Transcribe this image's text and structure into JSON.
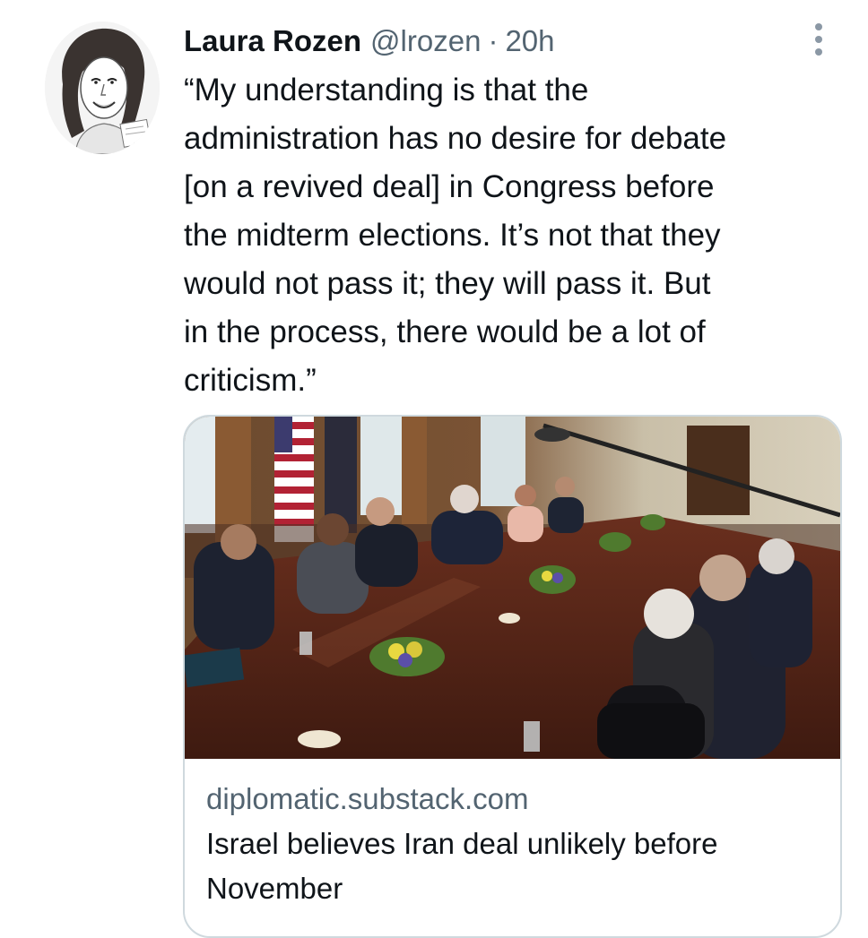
{
  "tweet": {
    "author_name": "Laura Rozen",
    "author_handle": "@lrozen",
    "separator": "·",
    "timestamp": "20h",
    "text": "“My understanding is that the\nadministration has no desire for debate\n[on a revived deal] in Congress before\nthe midterm elections. It’s not that they\nwould not pass it; they will pass it. But\nin the process, there would be a lot of\ncriticism.”",
    "more_icon": "more-vertical-icon"
  },
  "card": {
    "domain": "diplomatic.substack.com",
    "title": "Israel believes Iran deal unlikely before\nNovember"
  },
  "colors": {
    "text_primary": "#0f1419",
    "text_secondary": "#536471",
    "border": "#cfd9de",
    "more_dots": "#8b98a5"
  }
}
